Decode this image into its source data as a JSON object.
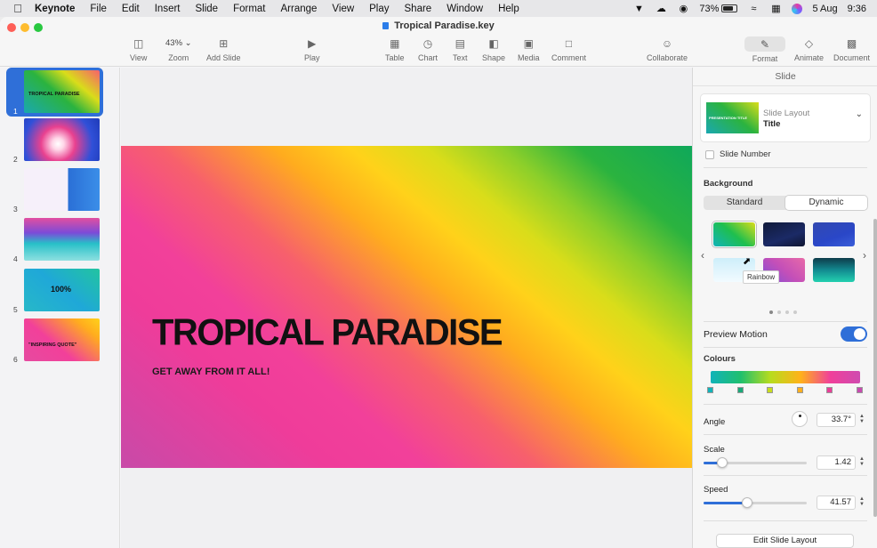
{
  "menubar": {
    "app": "Keynote",
    "items": [
      "File",
      "Edit",
      "Insert",
      "Slide",
      "Format",
      "Arrange",
      "View",
      "Play",
      "Share",
      "Window",
      "Help"
    ],
    "battery": "73%",
    "date": "5 Aug",
    "time": "9:36"
  },
  "window": {
    "title": "Tropical Paradise.key"
  },
  "toolbar": {
    "view": "View",
    "zoom_value": "43%",
    "zoom": "Zoom",
    "add_slide": "Add Slide",
    "play": "Play",
    "table": "Table",
    "chart": "Chart",
    "text": "Text",
    "shape": "Shape",
    "media": "Media",
    "comment": "Comment",
    "collaborate": "Collaborate",
    "format": "Format",
    "animate": "Animate",
    "document": "Document"
  },
  "navigator": {
    "slides": [
      {
        "num": "1",
        "label": "TROPICAL PARADISE"
      },
      {
        "num": "2",
        "label": ""
      },
      {
        "num": "3",
        "label": ""
      },
      {
        "num": "4",
        "label": ""
      },
      {
        "num": "5",
        "label": "100%"
      },
      {
        "num": "6",
        "label": "\"INSPIRING QUOTE\""
      }
    ]
  },
  "slide": {
    "title": "TROPICAL PARADISE",
    "subtitle": "GET AWAY FROM IT ALL!"
  },
  "inspector": {
    "header": "Slide",
    "layout_label": "Slide Layout",
    "layout_name": "Title",
    "layout_thumb_text": "PRESENTATION TITLE",
    "slide_number": "Slide Number",
    "background": "Background",
    "seg_standard": "Standard",
    "seg_dynamic": "Dynamic",
    "tooltip": "Rainbow",
    "preview_motion": "Preview Motion",
    "colours": "Colours",
    "angle": "Angle",
    "angle_value": "33.7°",
    "scale": "Scale",
    "scale_value": "1.42",
    "scale_level": 0.18,
    "speed": "Speed",
    "speed_value": "41.57",
    "speed_level": 0.42,
    "edit_layout": "Edit Slide Layout"
  },
  "colors": {
    "accent": "#2f6fd8"
  }
}
